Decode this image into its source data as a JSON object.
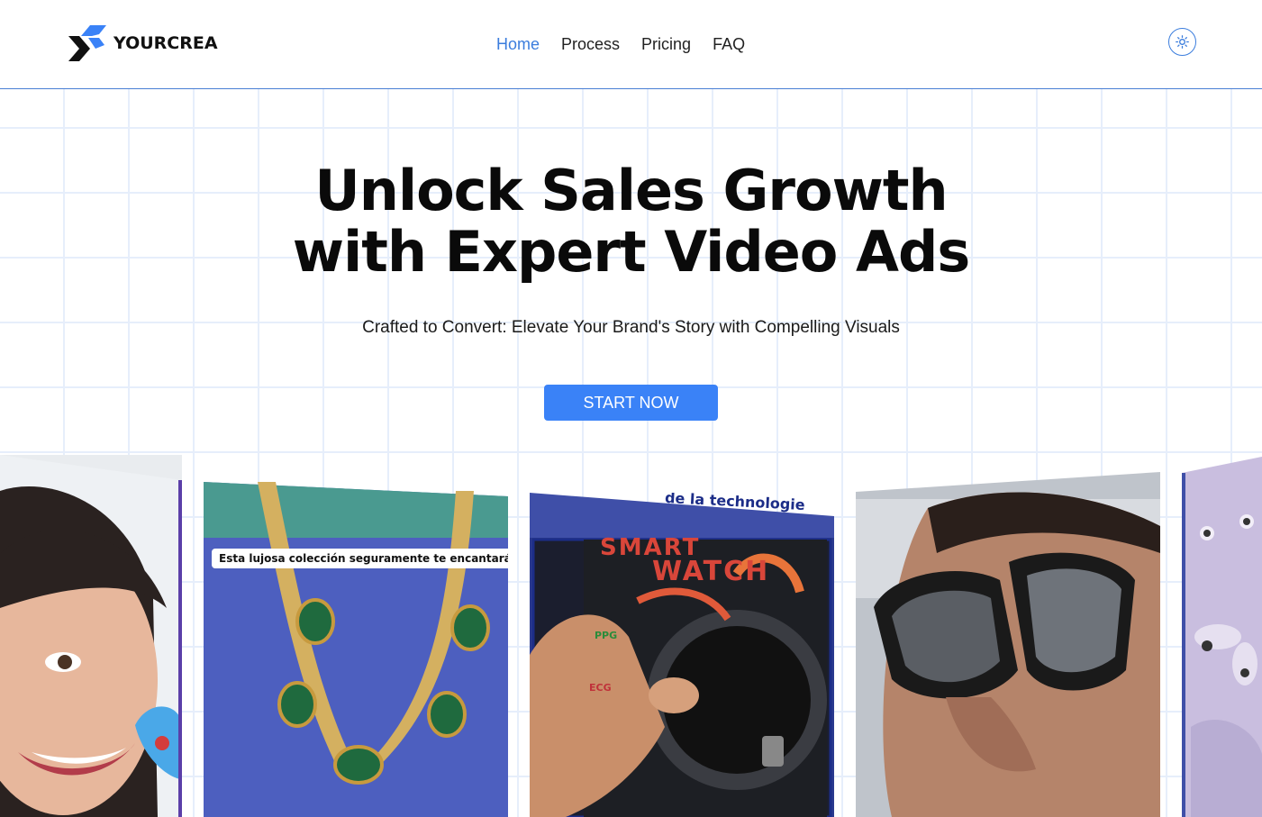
{
  "brand": {
    "name": "YOURCREA",
    "logo_icon": "double-chevron-logo-icon"
  },
  "nav": {
    "items": [
      {
        "label": "Home",
        "active": true
      },
      {
        "label": "Process",
        "active": false
      },
      {
        "label": "Pricing",
        "active": false
      },
      {
        "label": "FAQ",
        "active": false
      }
    ]
  },
  "theme_toggle": {
    "icon": "sun-icon"
  },
  "hero": {
    "title_line1": "Unlock Sales Growth",
    "title_line2": "with Expert Video Ads",
    "subtitle": "Crafted to Convert: Elevate Your Brand's Story with Compelling Visuals",
    "cta_label": "START NOW"
  },
  "cards": [
    {
      "subject": "woman smiling"
    },
    {
      "subject": "green gemstone necklace",
      "caption": "Esta lujosa colección seguramente te encantará"
    },
    {
      "subject": "smart watch",
      "banner": "de la technologie",
      "overlay_line1": "SMART",
      "overlay_line2": "WATCH",
      "labels": [
        "PPG",
        "ECG"
      ]
    },
    {
      "subject": "man with sunglasses"
    },
    {
      "subject": "lilac product"
    }
  ],
  "colors": {
    "accent": "#3a82f7",
    "nav_active": "#3b7ddd",
    "grid": "#e6eefb",
    "title": "#0a0a0a"
  }
}
